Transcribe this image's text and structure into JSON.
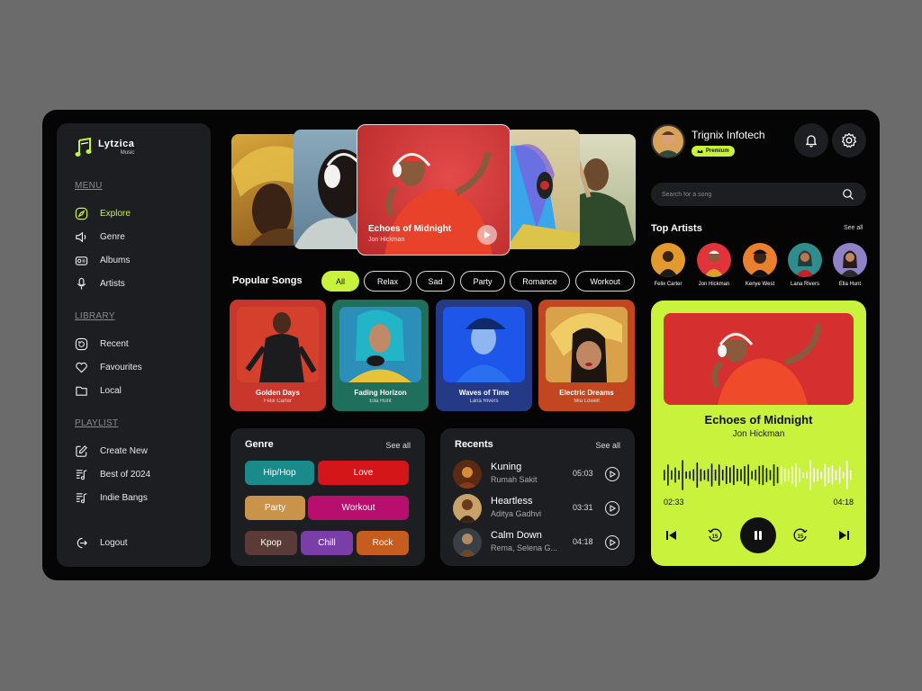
{
  "app": {
    "name": "Lytzica",
    "sub": "Music"
  },
  "sidebar": {
    "menu_title": "MENU",
    "menu": [
      {
        "label": "Explore",
        "icon": "compass-icon"
      },
      {
        "label": "Genre",
        "icon": "speaker-icon"
      },
      {
        "label": "Albums",
        "icon": "radio-icon"
      },
      {
        "label": "Artists",
        "icon": "microphone-icon"
      }
    ],
    "library_title": "LIBRARY",
    "library": [
      {
        "label": "Recent",
        "icon": "history-icon"
      },
      {
        "label": "Favourites",
        "icon": "heart-icon"
      },
      {
        "label": "Local",
        "icon": "folder-icon"
      }
    ],
    "playlist_title": "PLAYLIST",
    "playlist": [
      {
        "label": "Create New",
        "icon": "edit-icon"
      },
      {
        "label": "Best of 2024",
        "icon": "playlist-icon"
      },
      {
        "label": "Indie Bangs",
        "icon": "playlist-icon"
      }
    ],
    "logout": "Logout"
  },
  "carousel": {
    "hero_title": "Echoes of Midnight",
    "hero_artist": "Jon Hickman"
  },
  "popular": {
    "title": "Popular Songs",
    "filters": [
      "All",
      "Relax",
      "Sad",
      "Party",
      "Romance",
      "Workout"
    ],
    "active_filter": "All",
    "songs": [
      {
        "title": "Golden Days",
        "artist": "Felix Carter",
        "color": "#c9362b"
      },
      {
        "title": "Fading Horizon",
        "artist": "Ella Hunt",
        "color": "#1f6f5d"
      },
      {
        "title": "Waves of Time",
        "artist": "Lana Rivers",
        "color": "#243a86"
      },
      {
        "title": "Electric Dreams",
        "artist": "Mia Lowell",
        "color": "#c2461f"
      }
    ]
  },
  "genre": {
    "title": "Genre",
    "see_all": "See all",
    "items": [
      {
        "label": "Hip/Hop",
        "color": "#1a8a8a"
      },
      {
        "label": "Love",
        "color": "#d4161b"
      },
      {
        "label": "Party",
        "color": "#c9934a"
      },
      {
        "label": "Workout",
        "color": "#b80e6e"
      },
      {
        "label": "Kpop",
        "color": "#5a3b37"
      },
      {
        "label": "Chill",
        "color": "#7a3ea8"
      },
      {
        "label": "Rock",
        "color": "#c65c1e"
      }
    ]
  },
  "recents": {
    "title": "Recents",
    "see_all": "See all",
    "items": [
      {
        "title": "Kuning",
        "artist": "Rumah Sakit",
        "time": "05:03"
      },
      {
        "title": "Heartless",
        "artist": "Aditya Gadhvi",
        "time": "03:31"
      },
      {
        "title": "Calm Down",
        "artist": "Rema, Selena G...",
        "time": "04:18"
      }
    ]
  },
  "profile": {
    "name": "Trignix Infotech",
    "badge": "Premium"
  },
  "search": {
    "placeholder": "Search for a song"
  },
  "top_artists": {
    "title": "Top Artists",
    "see_all": "See all",
    "items": [
      {
        "name": "Felix Carter",
        "color": "#e19a2b"
      },
      {
        "name": "Jon Hickman",
        "color": "#e0333a"
      },
      {
        "name": "Kenye West",
        "color": "#e8802e"
      },
      {
        "name": "Lana Rivers",
        "color": "#2f8d8d"
      },
      {
        "name": "Ella Hunt",
        "color": "#8f82c7"
      }
    ]
  },
  "player": {
    "title": "Echoes of Midnight",
    "artist": "Jon Hickman",
    "current": "02:33",
    "total": "04:18",
    "progress": 0.6,
    "accent": "#c8f23c"
  }
}
